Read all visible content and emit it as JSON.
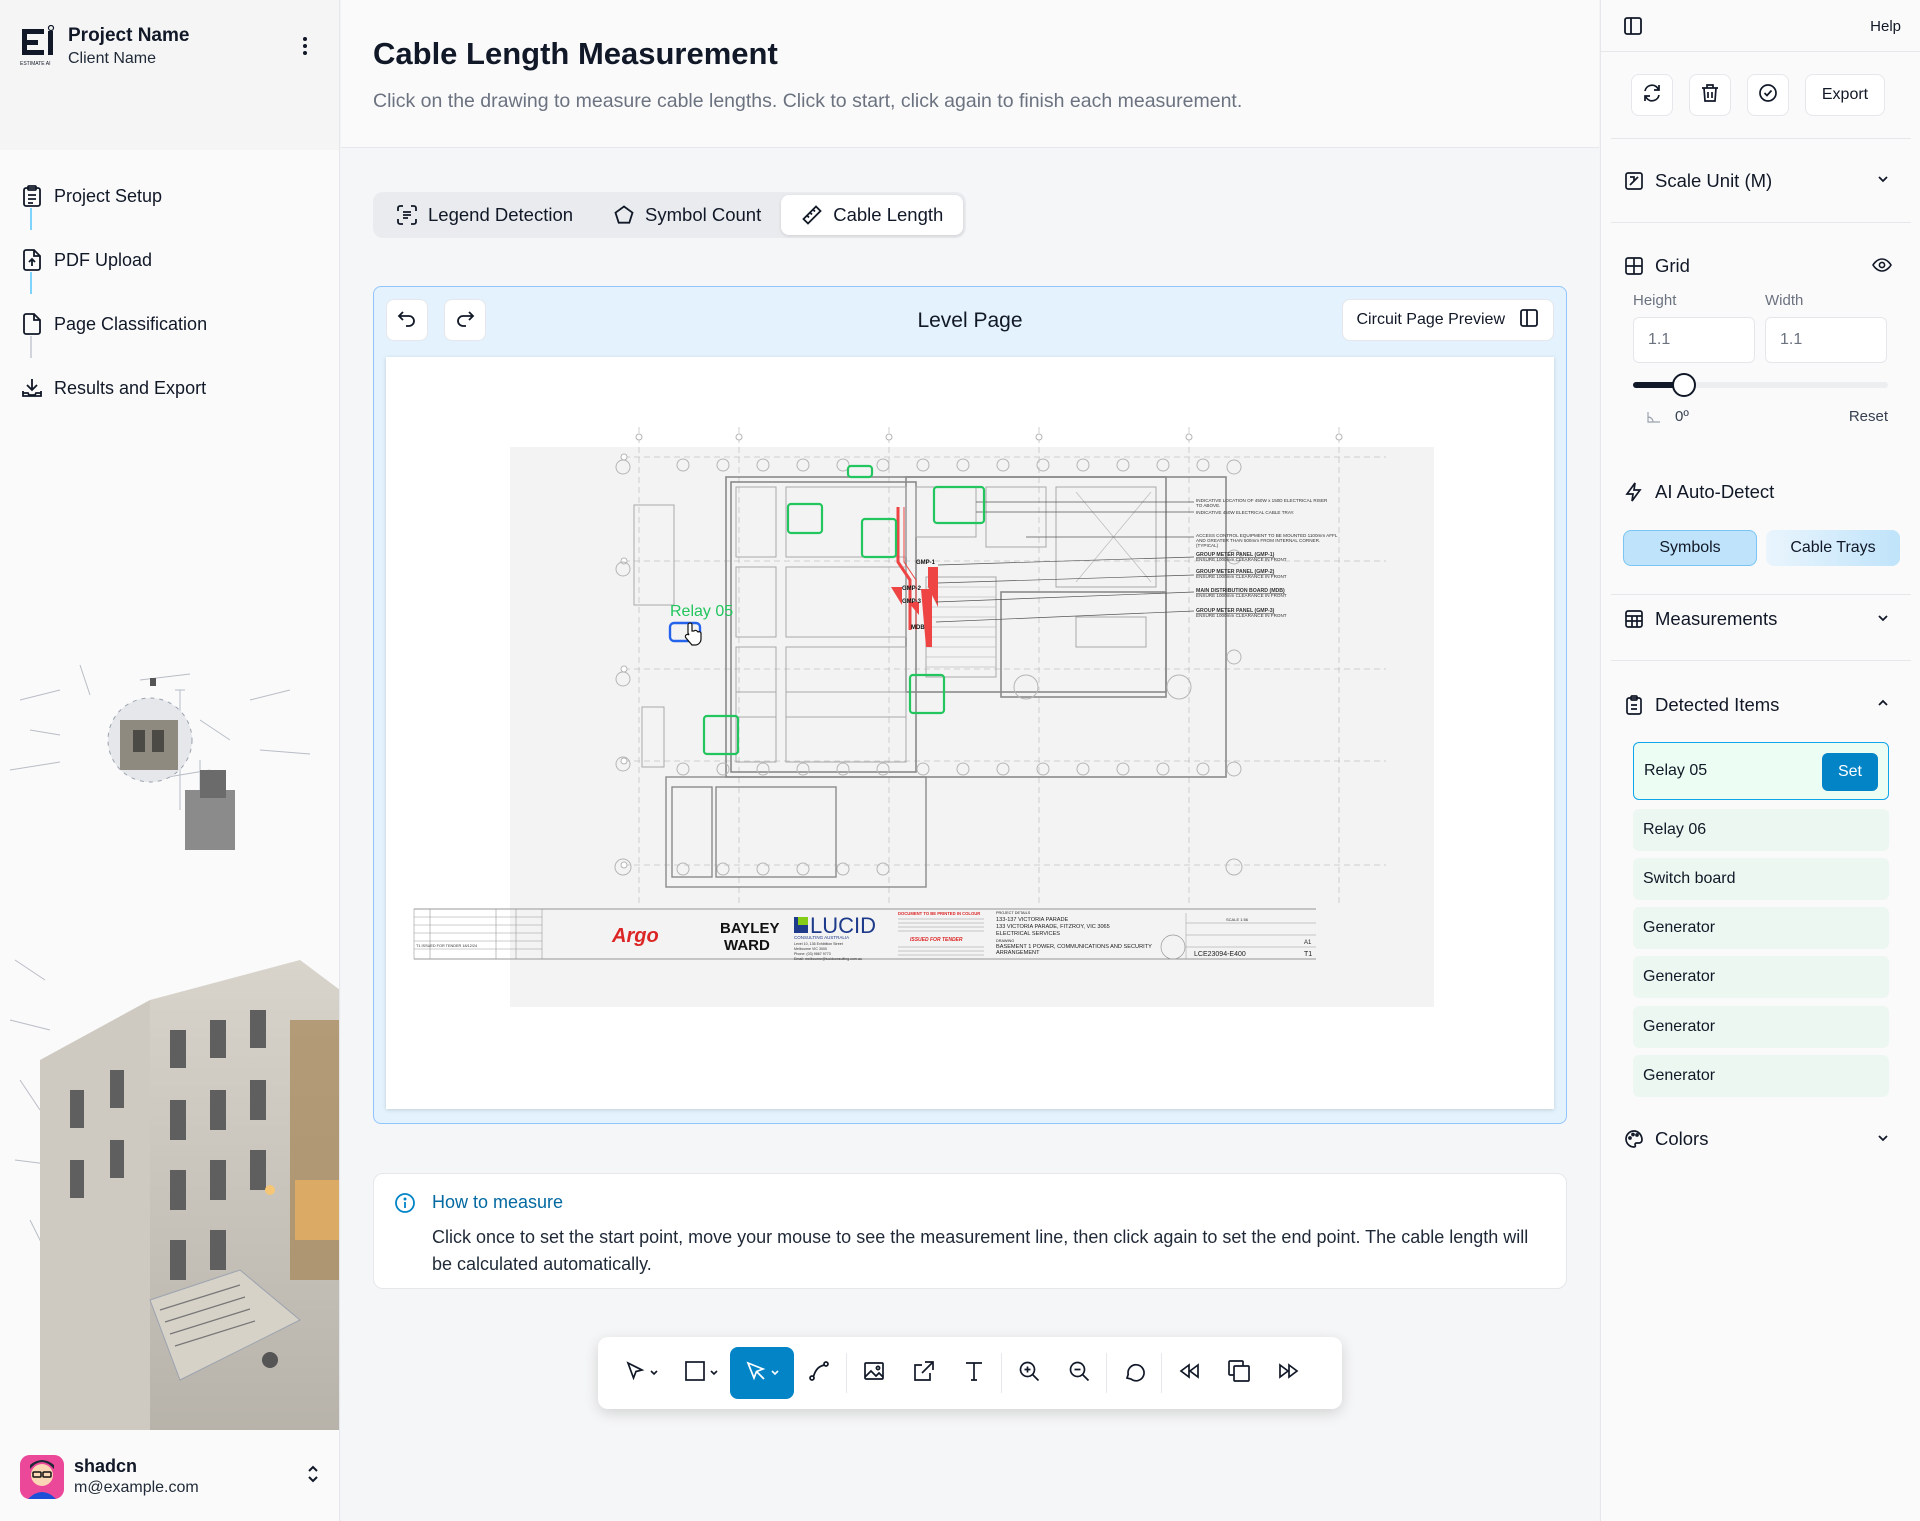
{
  "project": {
    "name": "Project Name",
    "client": "Client Name",
    "logo_text": "ESTIMATE AI"
  },
  "steps": [
    {
      "label": "Project Setup",
      "icon": "clipboard-list-icon"
    },
    {
      "label": "PDF Upload",
      "icon": "file-upload-icon"
    },
    {
      "label": "Page Classification",
      "icon": "file-icon"
    },
    {
      "label": "Results and Export",
      "icon": "download-tray-icon"
    }
  ],
  "user": {
    "name": "shadcn",
    "email": "m@example.com"
  },
  "header": {
    "title": "Cable Length Measurement",
    "subtitle": "Click on the drawing to measure cable lengths. Click to start, click again to finish each measurement."
  },
  "tabs": [
    {
      "label": "Legend Detection",
      "icon": "scan-text-icon",
      "active": false
    },
    {
      "label": "Symbol Count",
      "icon": "pentagon-icon",
      "active": false
    },
    {
      "label": "Cable Length",
      "icon": "ruler-icon",
      "active": true
    }
  ],
  "viewer": {
    "title": "Level Page",
    "preview_label": "Circuit Page Preview",
    "selected_label": "Relay 05",
    "drawing_notes": [
      "INDICATIVE LOCATION OF 450W x 150D ELECTRICAL RISER",
      "TO ABOVE.",
      "INDICATIVE 450W ELECTRICAL CABLE TRAY.",
      "ACCESS CONTROL EQUIPMENT TO BE MOUNTED 1100mm AFFL",
      "AND GREATER THAN 500mm FROM INTERNAL CORNER.",
      "(TYPICAL)",
      "GROUP METER PANEL (GMP-1)",
      "ENSURE 1000mm CLEARANCE IN FRONT",
      "GROUP METER PANEL (GMP-2)",
      "ENSURE 1000mm CLEARANCE IN FRONT",
      "MAIN DISTRIBUTION BOARD (MDB)",
      "ENSURE 1000mm CLEARANCE IN FRONT",
      "GROUP METER PANEL (GMP-3)",
      "ENSURE 1000mm CLEARANCE IN FRONT"
    ],
    "panel_labels": [
      "GMP-1",
      "GMP-2",
      "GMP-3",
      "MDB"
    ],
    "title_block": {
      "argo": "Argo",
      "bayley": "BAYLEY",
      "ward": "WARD",
      "lucid": "LUCID",
      "lucid_sub": "CONSULTING AUSTRALIA",
      "lucid_addr": "Level 10, 136 Exhibition Street",
      "lucid_city": "Melbourne VIC 3000",
      "lucid_phone": "Phone: (03) 9867 9773",
      "lucid_email": "Email: melbourne@lucidconsulting.com.au",
      "print_note": "DOCUMENT TO BE PRINTED IN COLOUR",
      "issued": "ISSUED FOR TENDER",
      "project_details": "PROJECT DETAILS",
      "address1": "133-137 VICTORIA PARADE",
      "address2": "133 VICTORIA PARADE, FITZROY, VIC 3065",
      "services": "ELECTRICAL SERVICES",
      "drawing_lbl": "DRAWING",
      "drawing1": "BASEMENT 1 POWER, COMMUNICATIONS AND SECURITY",
      "drawing2": "ARRANGEMENT",
      "drawing_no": "LCE23094-E400",
      "sheet": "A1",
      "revision": "T1",
      "scale": "SCALE 1:56",
      "revision_row": "T1   ISSUED FOR TENDER   18/12/24"
    }
  },
  "howto": {
    "title": "How to measure",
    "body": "Click once to set the start point, move your mouse to see the measurement line, then click again to set the end point. The cable length will be calculated automatically."
  },
  "toolbar": [
    "pointer-icon",
    "rectangle-icon",
    "pen-tool-icon",
    "curve-icon",
    "image-icon",
    "resize-icon",
    "text-icon",
    "zoom-in-icon",
    "zoom-out-icon",
    "comment-icon",
    "rewind-icon",
    "copy-page-icon",
    "fast-forward-icon"
  ],
  "right_panel": {
    "help": "Help",
    "export": "Export",
    "scale_unit": "Scale Unit (M)",
    "grid": {
      "title": "Grid",
      "height_label": "Height",
      "width_label": "Width",
      "height_placeholder": "1.1",
      "width_placeholder": "1.1",
      "angle": "0º",
      "reset": "Reset",
      "slider_fraction": 0.2
    },
    "ai": {
      "title": "AI Auto-Detect",
      "symbols": "Symbols",
      "cable_trays": "Cable Trays"
    },
    "measurements": "Measurements",
    "detected_title": "Detected Items",
    "set_label": "Set",
    "detected": [
      "Relay 05",
      "Relay 06",
      "Switch board",
      "Generator",
      "Generator",
      "Generator",
      "Generator"
    ],
    "colors": "Colors"
  },
  "colors": {
    "accent": "#0284c7",
    "symbol_box": "#22c55e",
    "selected_box": "#2563eb",
    "riser_red": "#ef4444"
  }
}
